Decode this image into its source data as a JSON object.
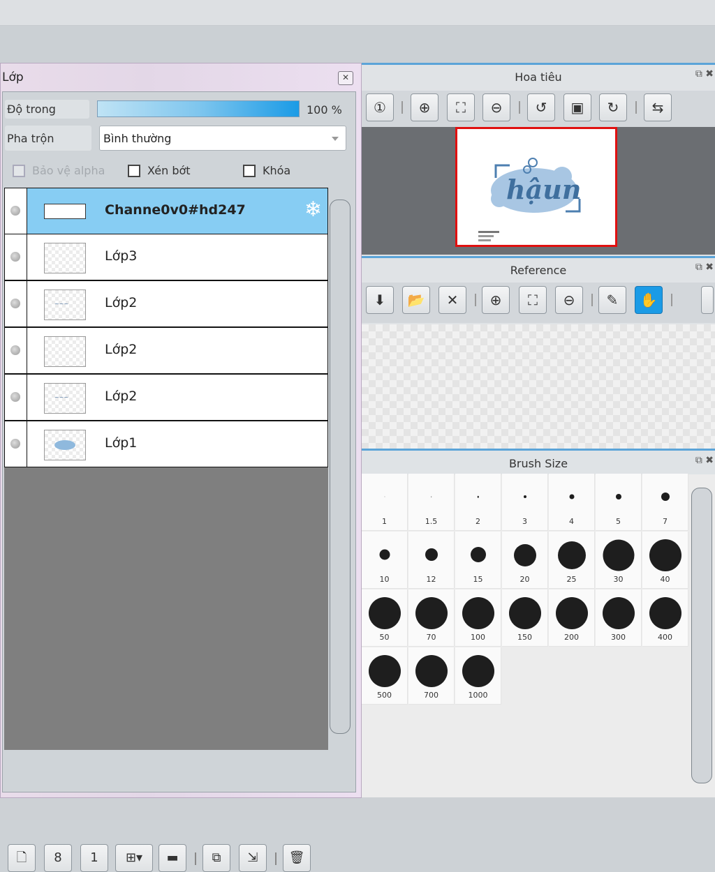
{
  "layer_panel": {
    "title": "Lớp",
    "close_icon": "close-icon",
    "opacity_label": "Độ trong",
    "opacity_value": "100 %",
    "opacity_level": 1.0,
    "blend_label": "Pha trộn",
    "blend_value": "Bình thường",
    "protect_alpha_label": "Bảo vệ alpha",
    "clip_label": "Xén bớt",
    "lock_label": "Khóa",
    "layers": [
      {
        "name": "Channe0v0#hd247",
        "selected": true
      },
      {
        "name": "Lớp3",
        "selected": false
      },
      {
        "name": "Lớp2",
        "selected": false
      },
      {
        "name": "Lớp2",
        "selected": false
      },
      {
        "name": "Lớp2",
        "selected": false
      },
      {
        "name": "Lớp1",
        "selected": false
      }
    ],
    "toolbar_icons": [
      "new-layer-icon",
      "new-8bit-layer-icon",
      "new-1bit-layer-icon",
      "add-layer-menu-icon",
      "new-folder-icon",
      "duplicate-layer-icon",
      "merge-down-icon",
      "delete-layer-icon"
    ],
    "toolbar_glyphs": {
      "b8": "8",
      "b1": "1"
    }
  },
  "navigator": {
    "title": "Hoa tiêu",
    "thumb_text": "hậun"
  },
  "reference": {
    "title": "Reference"
  },
  "brush_size": {
    "title": "Brush Size",
    "sizes": [
      "1",
      "1.5",
      "2",
      "3",
      "4",
      "5",
      "7",
      "10",
      "12",
      "15",
      "20",
      "25",
      "30",
      "40",
      "50",
      "70",
      "100",
      "150",
      "200",
      "300",
      "400",
      "500",
      "700",
      "1000"
    ]
  },
  "colors": {
    "selected_layer": "#87cdf3",
    "accent": "#1b9be6",
    "nav_frame": "#e01010"
  }
}
